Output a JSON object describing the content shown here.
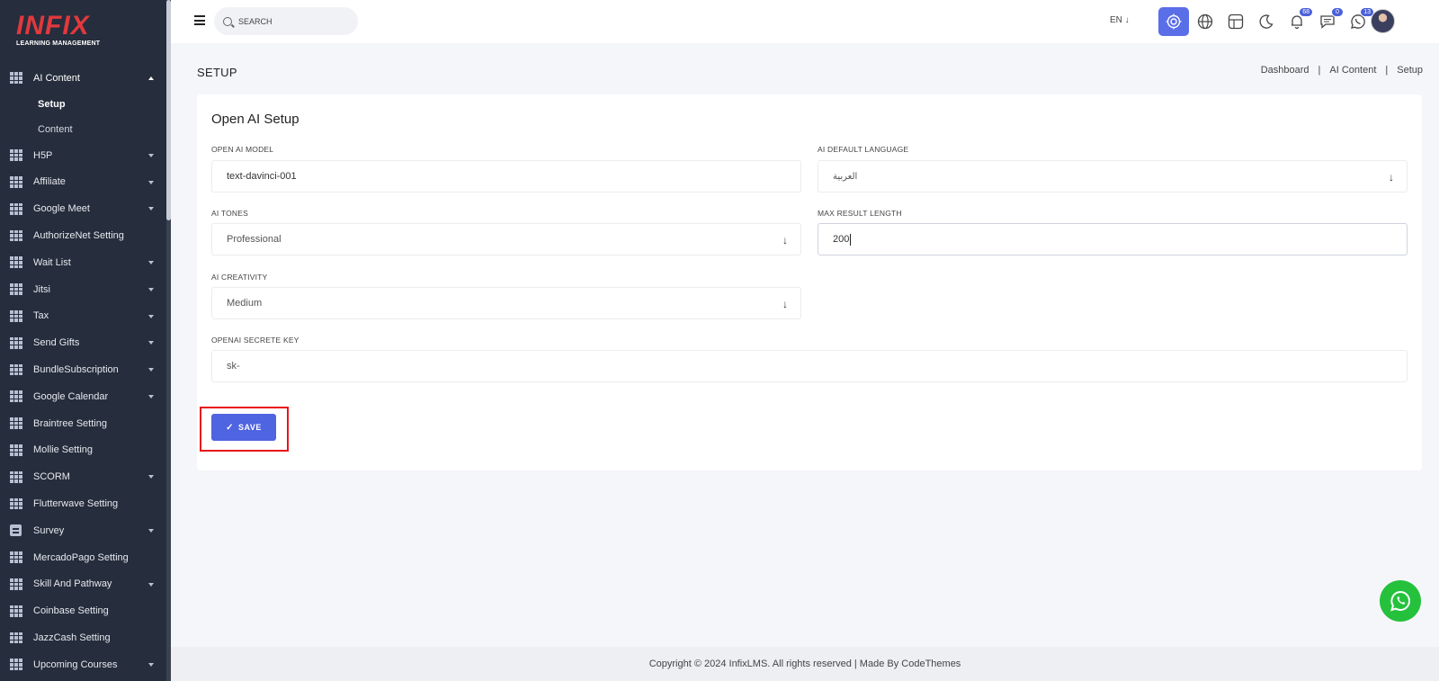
{
  "sidebar": {
    "logo": {
      "brand": "INFIX",
      "subtitle": "LEARNING MANAGEMENT"
    },
    "items": [
      {
        "label": "AI Content",
        "expanded": true,
        "children": [
          "Setup",
          "Content"
        ]
      },
      {
        "label": "H5P"
      },
      {
        "label": "Affiliate"
      },
      {
        "label": "Google Meet"
      },
      {
        "label": "AuthorizeNet Setting"
      },
      {
        "label": "Wait List"
      },
      {
        "label": "Jitsi"
      },
      {
        "label": "Tax"
      },
      {
        "label": "Send Gifts"
      },
      {
        "label": "BundleSubscription"
      },
      {
        "label": "Google Calendar"
      },
      {
        "label": "Braintree Setting"
      },
      {
        "label": "Mollie Setting"
      },
      {
        "label": "SCORM"
      },
      {
        "label": "Flutterwave Setting"
      },
      {
        "label": "Survey"
      },
      {
        "label": "MercadoPago Setting"
      },
      {
        "label": "Skill And Pathway"
      },
      {
        "label": "Coinbase Setting"
      },
      {
        "label": "JazzCash Setting"
      },
      {
        "label": "Upcoming Courses"
      }
    ]
  },
  "topbar": {
    "search_placeholder": "SEARCH",
    "language": "EN ↓",
    "notifications_count": "68",
    "messages_count": "0",
    "whatsapp_count": "13"
  },
  "page": {
    "title": "SETUP",
    "breadcrumb": [
      "Dashboard",
      "AI Content",
      "Setup"
    ],
    "separator": "|"
  },
  "form": {
    "card_title": "Open AI Setup",
    "model_label": "OPEN AI MODEL",
    "model_value": "text-davinci-001",
    "language_label": "AI DEFAULT LANGUAGE",
    "language_value": "العربية",
    "tones_label": "AI TONES",
    "tones_value": "Professional",
    "max_length_label": "MAX RESULT LENGTH",
    "max_length_value": "200",
    "creativity_label": "AI CREATIVITY",
    "creativity_value": "Medium",
    "key_label": "OPENAI SECRETE KEY",
    "key_value": "sk-",
    "save_label": "SAVE"
  },
  "footer": {
    "text": "Copyright © 2024 InfixLMS. All rights reserved | Made By CodeThemes"
  },
  "colors": {
    "sidebar_bg": "#262d3c",
    "accent": "#4f64e0",
    "highlight_outline": "#e8141b",
    "whatsapp": "#25c13d"
  }
}
